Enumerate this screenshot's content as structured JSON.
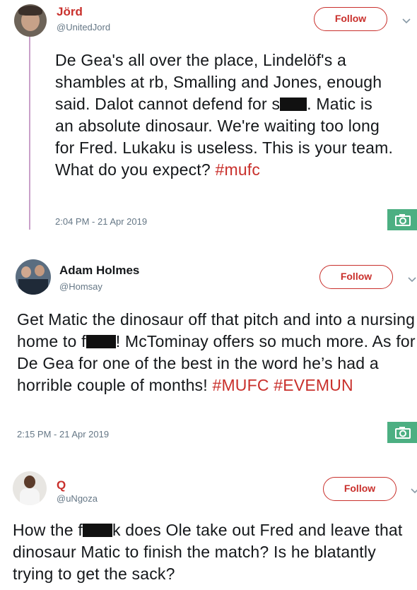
{
  "tweets": [
    {
      "name": "Jörd",
      "handle": "@UnitedJord",
      "follow_label": "Follow",
      "text_parts": [
        "De Gea's all over the place, Lindelöf's a shambles at rb, Smalling and Jones, enough said. Dalot cannot defend for s",
        ". Matic is an absolute dinosaur. We're waiting too long for Fred. Lukaku is useless. This  is your team. What do you expect?"
      ],
      "hashtags": "#mufc",
      "timestamp": "2:04 PM - 21 Apr 2019"
    },
    {
      "name": "Adam Holmes",
      "handle": "@Homsay",
      "follow_label": "Follow",
      "text_parts": [
        "Get Matic the dinosaur off that pitch and into a nursing home to f",
        "! McTominay offers so much more. As for De Gea for one of the best in the word he’s had a horrible couple of months!"
      ],
      "hashtags": "#MUFC #EVEMUN",
      "timestamp": "2:15 PM - 21 Apr 2019"
    },
    {
      "name": "Q",
      "handle": "@uNgoza",
      "follow_label": "Follow",
      "text_parts": [
        "How the f",
        "k does Ole take out Fred and leave that dinosaur Matic to finish the match? Is he blatantly trying to get the sack?"
      ]
    }
  ],
  "colors": {
    "accent": "#c9302c",
    "camera_badge": "#4caf82"
  }
}
